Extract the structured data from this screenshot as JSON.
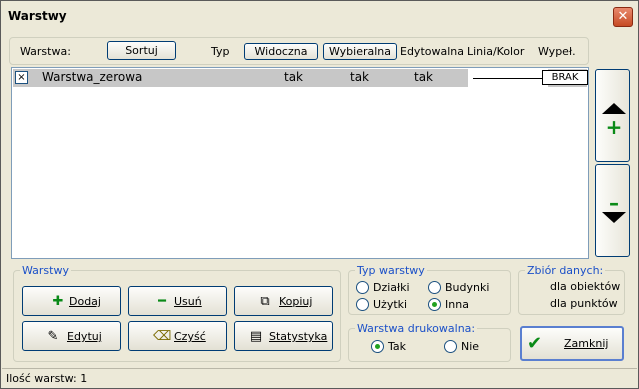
{
  "window": {
    "title": "Warstwy",
    "close_icon": "close-icon"
  },
  "header": {
    "warstwa_label": "Warstwa:",
    "sort_button": "Sortuj",
    "typ_label": "Typ",
    "visible_button": "Widoczna",
    "selectable_button": "Wybieralna",
    "editable_label": "Edytowalna",
    "line_color_label": "Linia/Kolor",
    "fill_label": "Wypeł."
  },
  "layers": [
    {
      "checked": "×",
      "name": "Warstwa_zerowa",
      "visible": "tak",
      "selectable": "tak",
      "editable": "tak",
      "fill": "BRAK"
    }
  ],
  "side_buttons": {
    "move_up_icon": "arrow-up-plus-icon",
    "move_down_icon": "arrow-down-minus-icon"
  },
  "layers_group": {
    "legend": "Warstwy",
    "add": "Dodaj",
    "remove": "Usuń",
    "copy": "Kopiuj",
    "edit": "Edytuj",
    "clear": "Czyść",
    "stats": "Statystyka"
  },
  "layer_type": {
    "legend": "Typ warstwy",
    "options": [
      "Działki",
      "Budynki",
      "Użytki",
      "Inna"
    ],
    "selected": "Inna"
  },
  "printable": {
    "legend": "Warstwa drukowalna:",
    "yes": "Tak",
    "no": "Nie",
    "selected": "Tak"
  },
  "data_set": {
    "legend": "Zbiór danych:",
    "line1": "dla obiektów",
    "line2": "dla punktów"
  },
  "close_button": "Zamknij",
  "status": {
    "text": "Ilość warstw: 1"
  },
  "colors": {
    "accent_blue": "#1b50c8",
    "row_highlight": "#c7c7c7",
    "radio_selected": "#21a121",
    "add_green": "#0a8a17"
  }
}
